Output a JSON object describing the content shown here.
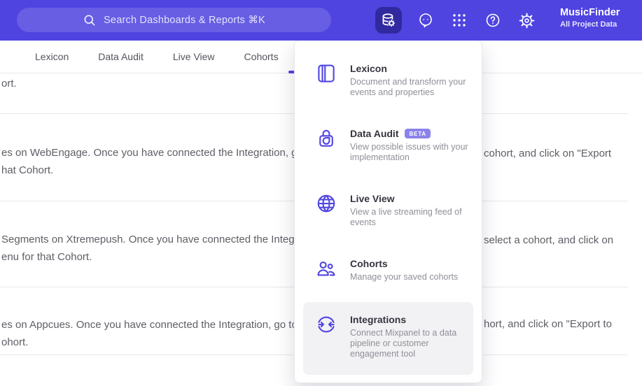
{
  "colors": {
    "header_bg": "#4f44e0",
    "accent": "#4f44e0",
    "badge_bg": "#8c82ec",
    "highlight_bg": "#f2f2f4",
    "page_gray": "#f4f4f6"
  },
  "header": {
    "search_label": "Search Dashboards & Reports ⌘K",
    "project_name": "MusicFinder",
    "project_subtitle": "All Project Data",
    "icons": [
      "data-management-icon",
      "feedback-chat-icon",
      "apps-grid-icon",
      "help-icon",
      "settings-gear-icon",
      "chevron-down-icon"
    ]
  },
  "nav": {
    "tabs": [
      "Lexicon",
      "Data Audit",
      "Live View",
      "Cohorts"
    ]
  },
  "menu": {
    "items": [
      {
        "title": "Lexicon",
        "icon": "book-icon",
        "desc": "Document and transform your events and properties"
      },
      {
        "title": "Data Audit",
        "badge": "BETA",
        "icon": "audit-lock-icon",
        "desc": "View possible issues with your implementation"
      },
      {
        "title": "Live View",
        "icon": "globe-icon",
        "desc": "View a live streaming feed of events"
      },
      {
        "title": "Cohorts",
        "icon": "users-icon",
        "desc": "Manage your saved cohorts"
      },
      {
        "title": "Integrations",
        "icon": "sync-arrows-icon",
        "desc": "Connect Mixpanel to a data pipeline or customer engagement tool"
      }
    ]
  },
  "content": {
    "partial_row": "ort.",
    "rows": [
      {
        "line1_left": "es on WebEngage. Once you have connected the Integration, go to the",
        "line1_right": "cohort, and click on \"Export",
        "line2_left": "hat Cohort."
      },
      {
        "line1_left": "Segments on Xtremepush. Once you have connected the Integration,",
        "line1_right": "select a cohort, and click on",
        "line2_left": "enu for that Cohort."
      },
      {
        "line1_left": "es on Appcues. Once you have connected the Integration, go to the M",
        "line1_right": "hort, and click on \"Export to",
        "line2_left": "ohort."
      }
    ]
  }
}
